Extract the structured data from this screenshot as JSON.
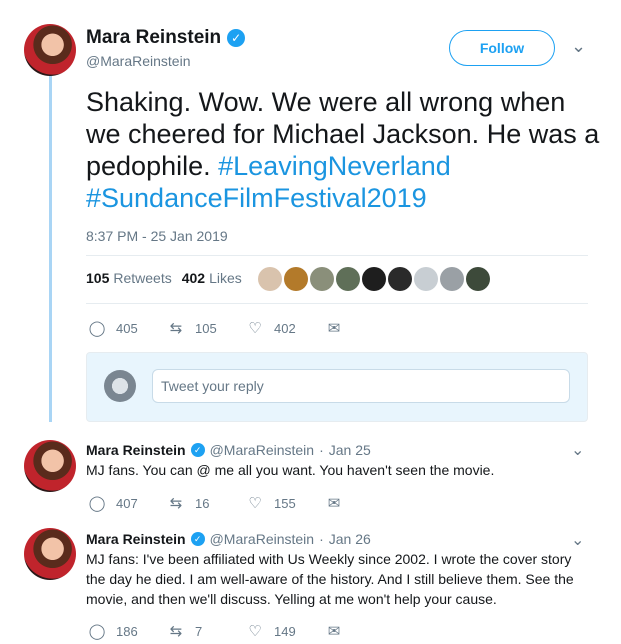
{
  "main_tweet": {
    "name": "Mara Reinstein",
    "handle": "@MaraReinstein",
    "follow_label": "Follow",
    "text_plain": "Shaking. Wow. We were all wrong when we cheered for Michael Jackson. He was a pedophile. ",
    "hashtag1": "#LeavingNeverland",
    "hashtag2": "#SundanceFilmFestival2019",
    "timestamp": "8:37 PM - 25 Jan 2019",
    "retweets_count": "105",
    "retweets_label": "Retweets",
    "likes_count": "402",
    "likes_label": "Likes",
    "actions": {
      "replies": "405",
      "retweets": "105",
      "likes": "402"
    }
  },
  "reply_box": {
    "placeholder": "Tweet your reply"
  },
  "replies": [
    {
      "name": "Mara Reinstein",
      "handle": "@MaraReinstein",
      "date": "Jan 25",
      "text": "MJ fans. You can @ me all you want. You haven't seen the movie.",
      "actions": {
        "replies": "407",
        "retweets": "16",
        "likes": "155"
      }
    },
    {
      "name": "Mara Reinstein",
      "handle": "@MaraReinstein",
      "date": "Jan 26",
      "text": "MJ fans: I've been affiliated with Us Weekly since 2002. I wrote the cover story the day he died. I am well-aware of the history. And I still believe them. See the movie, and then we'll discuss. Yelling at me won't help your cause.",
      "actions": {
        "replies": "186",
        "retweets": "7",
        "likes": "149"
      }
    }
  ],
  "icons": {
    "verified": "✓",
    "reply": "◯",
    "retweet": "⇆",
    "like": "♡",
    "dm": "✉",
    "chevron": "⌄"
  },
  "colors": {
    "accent": "#1da1f2",
    "muted": "#657786",
    "thread_line": "#a9d5f5"
  }
}
